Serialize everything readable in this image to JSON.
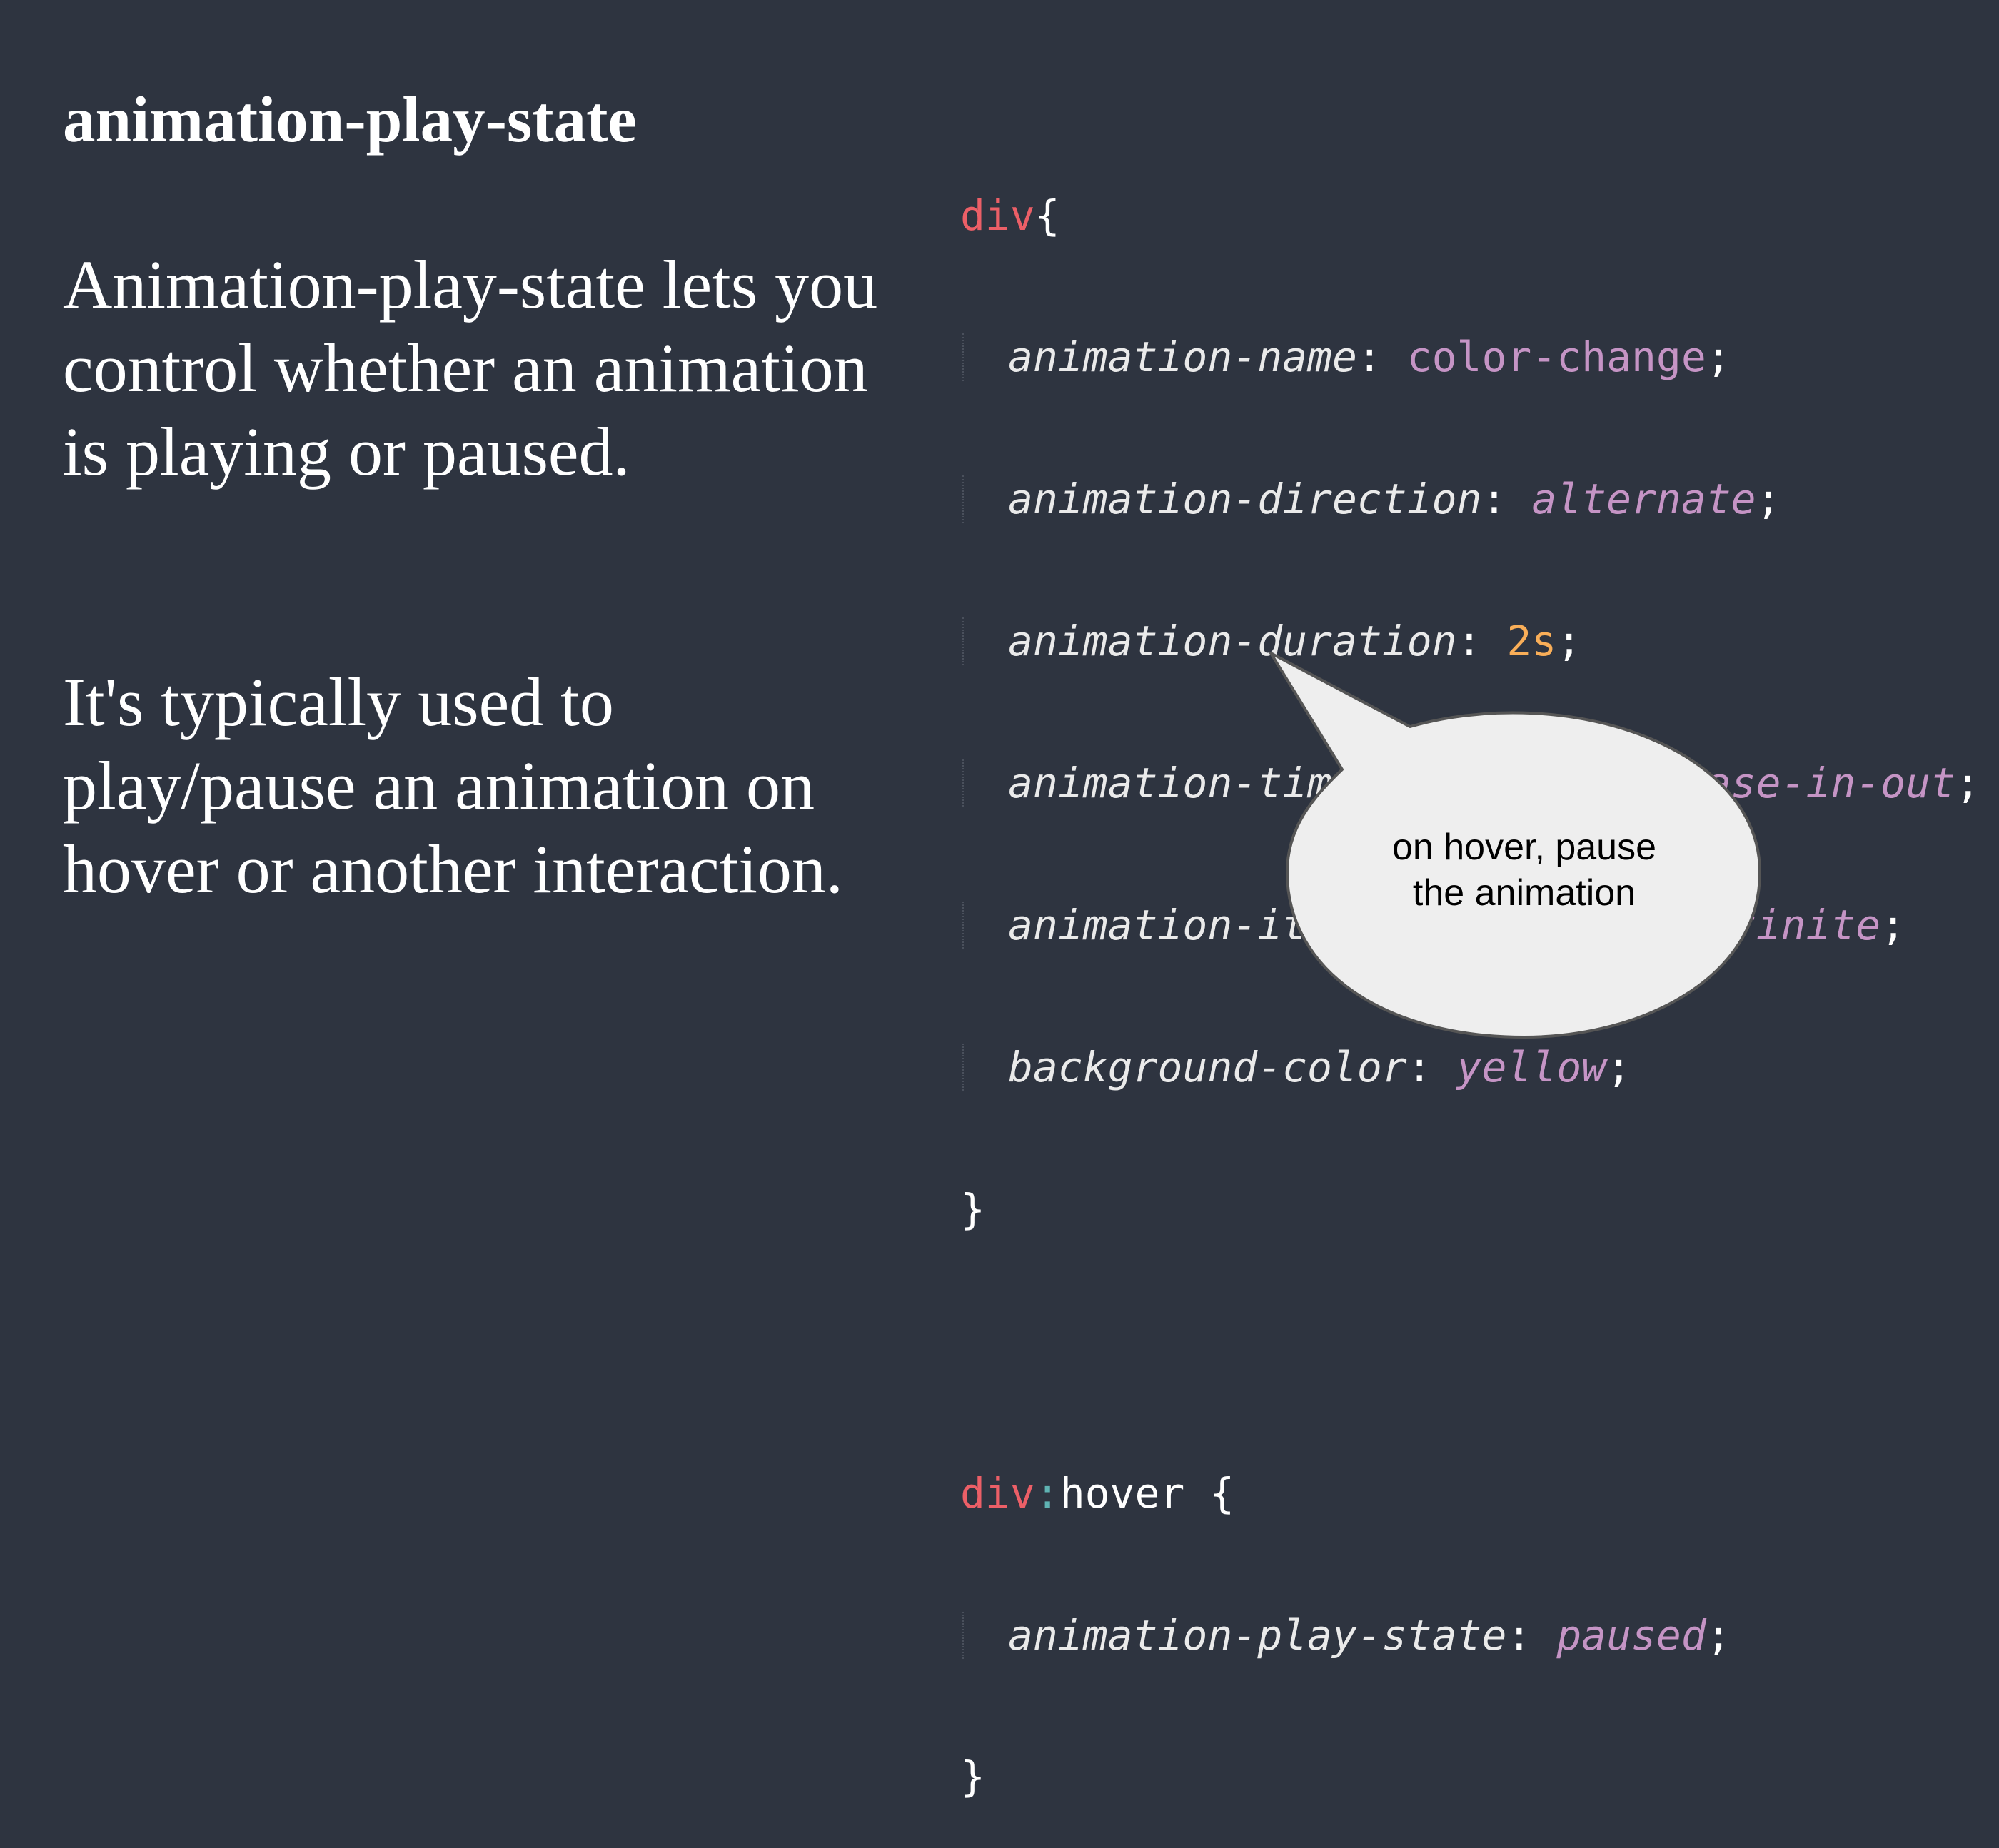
{
  "slide": {
    "title": "animation-play-state",
    "paragraph_1": "Animation-play-state lets you control whether an animation is playing or paused.",
    "paragraph_2": "It's typically used to play/pause an animation on hover or another interaction."
  },
  "code": {
    "block_1": {
      "selector": "div",
      "open_brace": "{",
      "close_brace": "}",
      "declarations": [
        {
          "property": "animation-name",
          "value": "color-change"
        },
        {
          "property": "animation-direction",
          "value": "alternate"
        },
        {
          "property": "animation-duration",
          "value": "2s"
        },
        {
          "property": "animation-timing-function",
          "value": "ease-in-out"
        },
        {
          "property": "animation-iteration-count",
          "value": "infinite"
        },
        {
          "property": "background-color",
          "value": "yellow"
        }
      ]
    },
    "block_2": {
      "selector": "div",
      "pseudo_colon": ":",
      "pseudo": "hover",
      "open_brace": " {",
      "close_brace": "}",
      "declarations": [
        {
          "property": "animation-play-state",
          "value": "paused"
        }
      ]
    },
    "colon": ":",
    "semicolon": ";"
  },
  "callout": {
    "line_1": "on hover, pause",
    "line_2": "the animation"
  },
  "colors": {
    "background": "#2e3440",
    "selector": "#ec5f67",
    "value": "#c594c5",
    "number": "#f9ae58",
    "callout_fill": "#eeeeee"
  }
}
